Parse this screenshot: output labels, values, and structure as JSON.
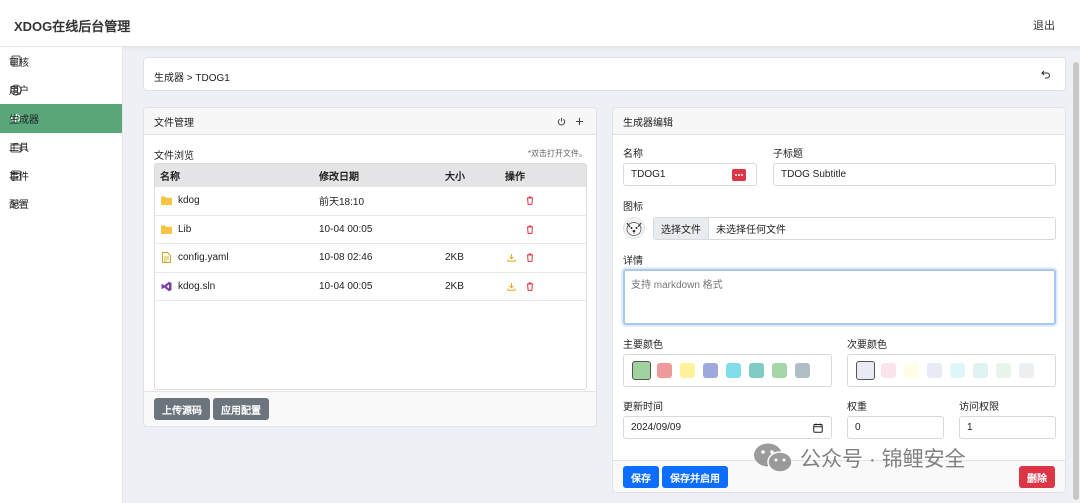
{
  "header": {
    "brand": "XDOG在线后台管理",
    "logout": "退出"
  },
  "sidebar": {
    "items": [
      {
        "label": "审核",
        "icon": "review-icon",
        "active": false
      },
      {
        "label": "用户",
        "icon": "user-icon",
        "active": false
      },
      {
        "label": "生成器",
        "icon": "code-icon",
        "active": true
      },
      {
        "label": "工具",
        "icon": "toolbox-icon",
        "active": false
      },
      {
        "label": "事件",
        "icon": "calendar-icon",
        "active": false
      },
      {
        "label": "配置",
        "icon": "gear-icon",
        "active": false
      }
    ],
    "active_color": "#58a67a"
  },
  "breadcrumb": {
    "text": "生成器 > TDOG1"
  },
  "files": {
    "title": "文件管理",
    "browse_label": "文件浏览",
    "hint": "*双击打开文件。",
    "columns": [
      "名称",
      "修改日期",
      "大小",
      "操作"
    ],
    "rows": [
      {
        "name": "kdog",
        "date": "前天18:10",
        "size": "",
        "type": "folder",
        "ops": [
          "delete"
        ]
      },
      {
        "name": "Lib",
        "date": "10-04 00:05",
        "size": "",
        "type": "folder",
        "ops": [
          "delete"
        ]
      },
      {
        "name": "config.yaml",
        "date": "10-08 02:46",
        "size": "2KB",
        "type": "text-file",
        "ops": [
          "download",
          "delete"
        ]
      },
      {
        "name": "kdog.sln",
        "date": "10-04 00:05",
        "size": "2KB",
        "type": "solution-file",
        "ops": [
          "download",
          "delete"
        ]
      }
    ],
    "upload_button": "上传源码",
    "apply_button": "应用配置"
  },
  "editor": {
    "title": "生成器编辑",
    "name_label": "名称",
    "name_value": "TDOG1",
    "subtitle_label": "子标题",
    "subtitle_value": "TDOG Subtitle",
    "icon_label": "图标",
    "choose_file": "选择文件",
    "no_file": "未选择任何文件",
    "detail_label": "详情",
    "detail_placeholder": "支持 markdown 格式",
    "primary_color_label": "主要颜色",
    "primary_colors": [
      "#a0d2a0",
      "#ef9a9a",
      "#fff29a",
      "#9fa8da",
      "#80deea",
      "#80cbc4",
      "#a5d6a7",
      "#b0bec5"
    ],
    "secondary_color_label": "次要颜色",
    "secondary_colors": [
      "#e8eaf6",
      "#fce4ec",
      "#fffde7",
      "#e8eaf6",
      "#e0f7fa",
      "#e0f2f1",
      "#e8f5e9",
      "#eceff1"
    ],
    "update_time_label": "更新时间",
    "update_time_value": "2024/09/09",
    "weight_label": "权重",
    "weight_value": "0",
    "access_label": "访问权限",
    "access_value": "1",
    "save_button": "保存",
    "save_enable_button": "保存并启用",
    "delete_button": "删除"
  },
  "watermark": {
    "text": "公众号 · 锦鲤安全"
  }
}
